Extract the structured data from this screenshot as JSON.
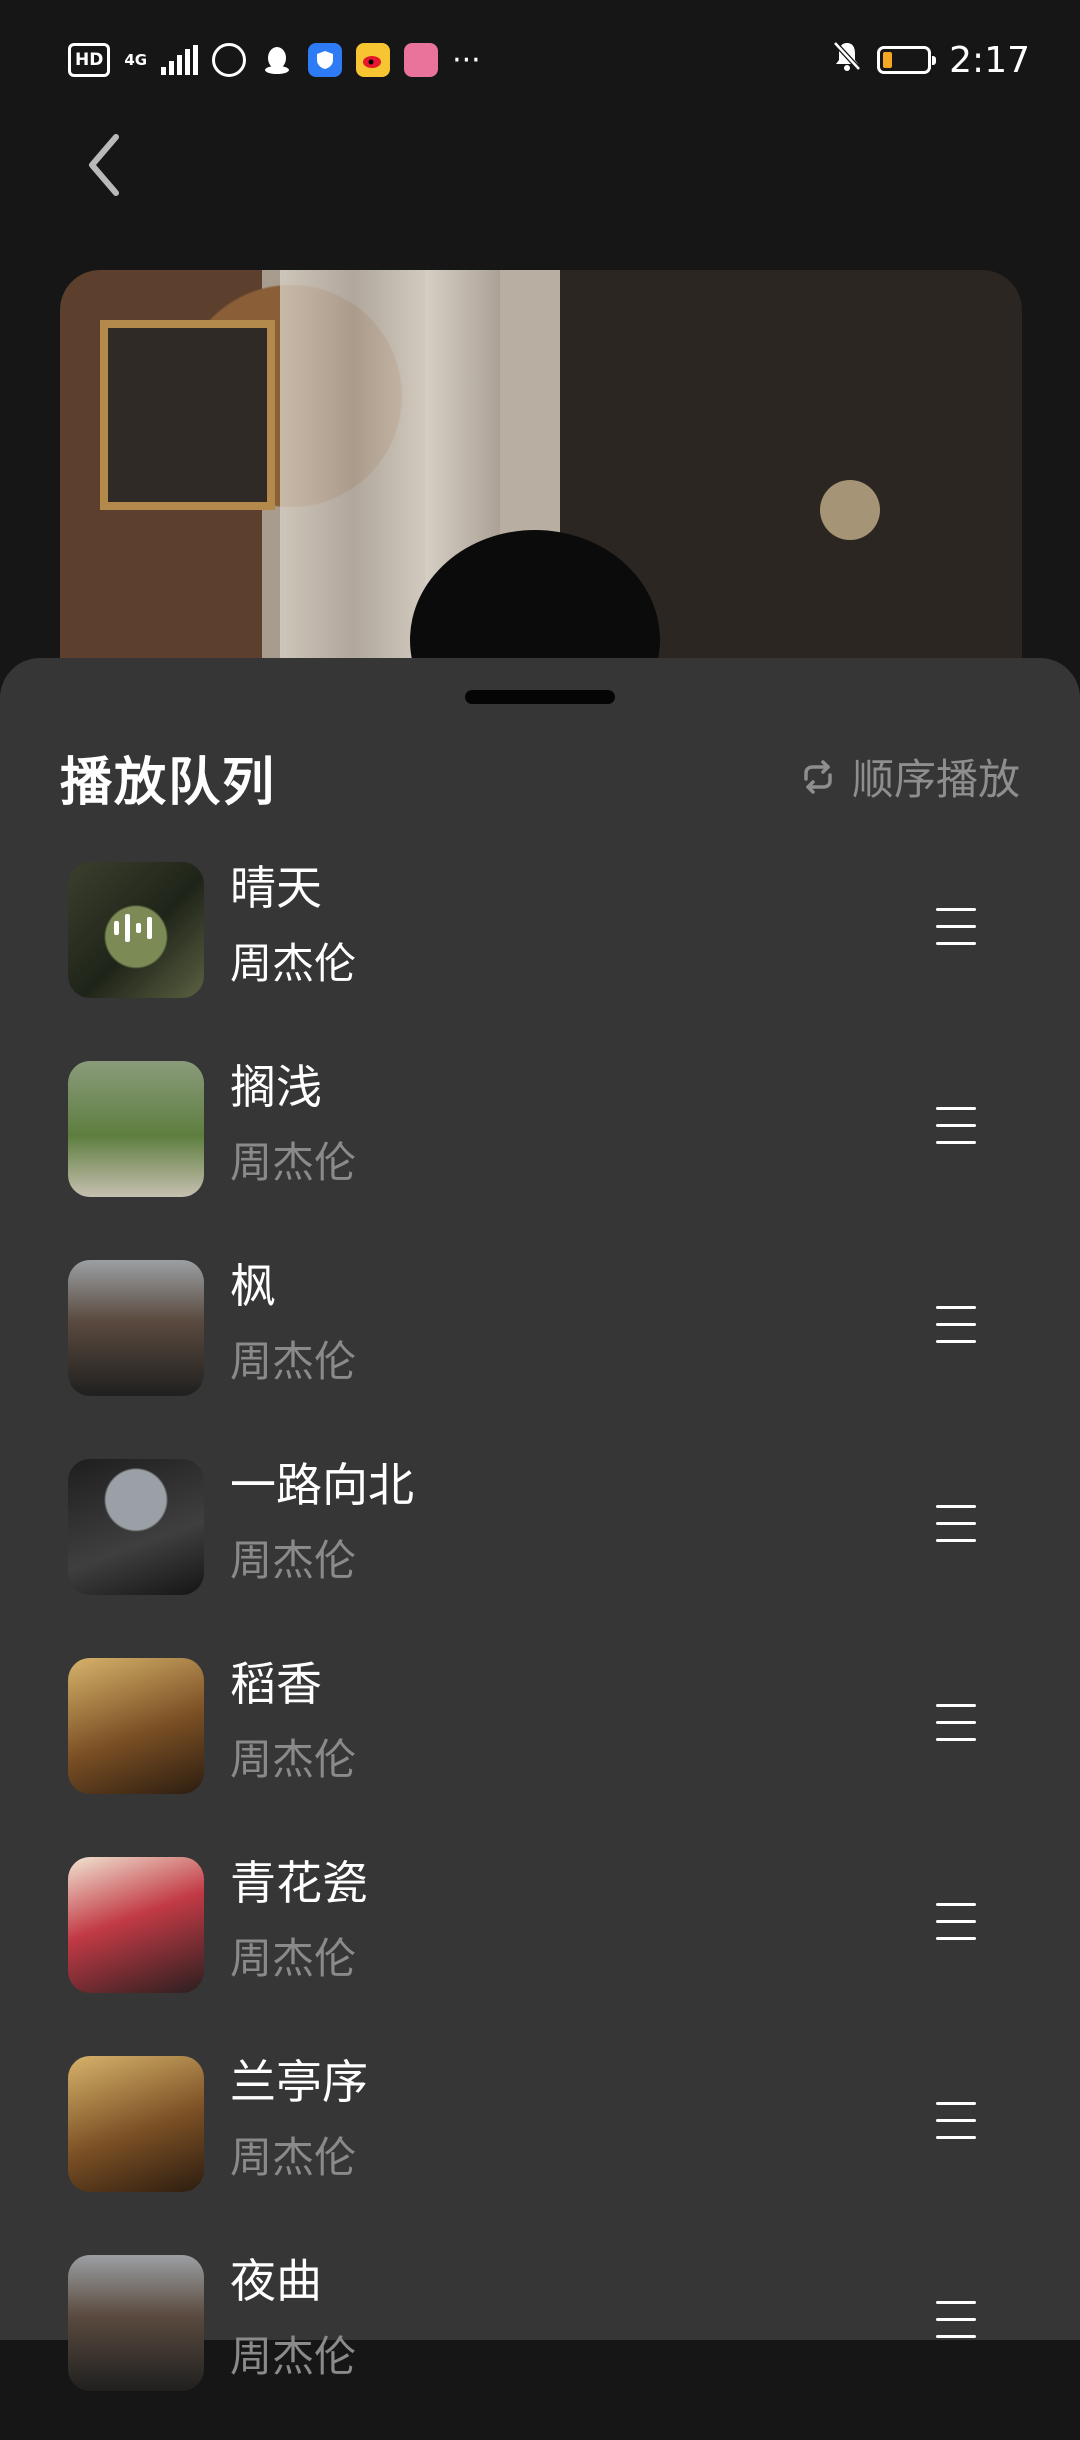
{
  "status_bar": {
    "hd": "HD",
    "network": "4G",
    "time": "2:17",
    "more": "···",
    "battery_level": 0.2
  },
  "header": {
    "back_icon": "chevron-left-icon"
  },
  "queue_sheet": {
    "title": "播放队列",
    "play_mode_label": "顺序播放",
    "play_mode_icon": "repeat-icon"
  },
  "queue": [
    {
      "title": "晴天",
      "artist": "周杰伦",
      "playing": true
    },
    {
      "title": "搁浅",
      "artist": "周杰伦",
      "playing": false
    },
    {
      "title": "枫",
      "artist": "周杰伦",
      "playing": false
    },
    {
      "title": "一路向北",
      "artist": "周杰伦",
      "playing": false
    },
    {
      "title": "稻香",
      "artist": "周杰伦",
      "playing": false
    },
    {
      "title": "青花瓷",
      "artist": "周杰伦",
      "playing": false
    },
    {
      "title": "兰亭序",
      "artist": "周杰伦",
      "playing": false
    },
    {
      "title": "夜曲",
      "artist": "周杰伦",
      "playing": false
    }
  ],
  "colors": {
    "background": "#161616",
    "sheet": "#363636",
    "secondary_text": "#8a8a8a",
    "battery_fill": "#f5a623"
  }
}
